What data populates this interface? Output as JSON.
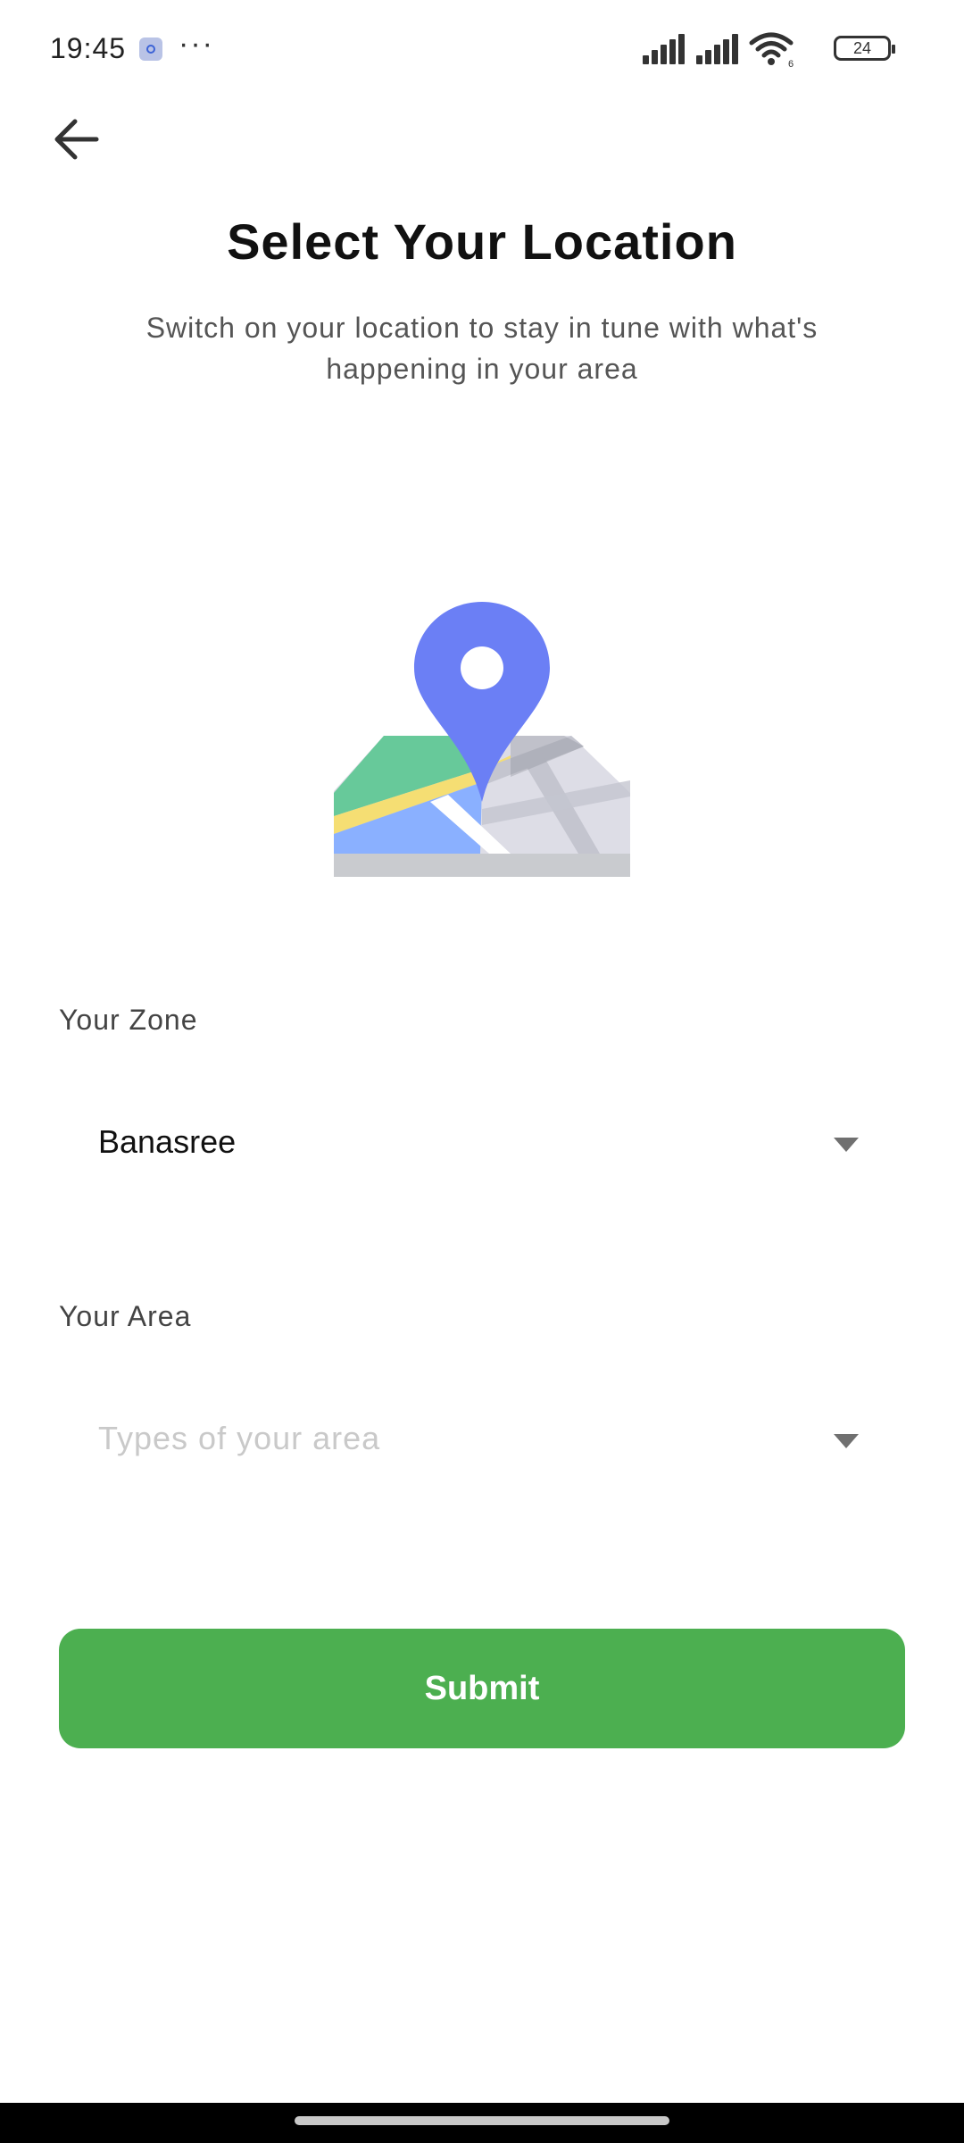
{
  "status_bar": {
    "time": "19:45",
    "more_dots": "···",
    "wifi_label": "6",
    "battery_level": "24"
  },
  "header": {
    "title": "Select Your Location",
    "subtitle": "Switch on your location to stay in tune with what's happening in your area"
  },
  "illustration": {
    "icon": "map-pin-icon",
    "colors": {
      "pin": "#6b7ff5",
      "map_green": "#67c99a",
      "map_yellow": "#f5de73",
      "map_blue": "#8ab0ff",
      "map_gray": "#dddde6"
    }
  },
  "form": {
    "zone": {
      "label": "Your Zone",
      "value": "Banasree"
    },
    "area": {
      "label": "Your Area",
      "placeholder": "Types of your area"
    },
    "submit_label": "Submit"
  },
  "colors": {
    "accent": "#4caf50",
    "text_primary": "#111111",
    "text_secondary": "#555555",
    "placeholder": "#c9c9c9"
  }
}
